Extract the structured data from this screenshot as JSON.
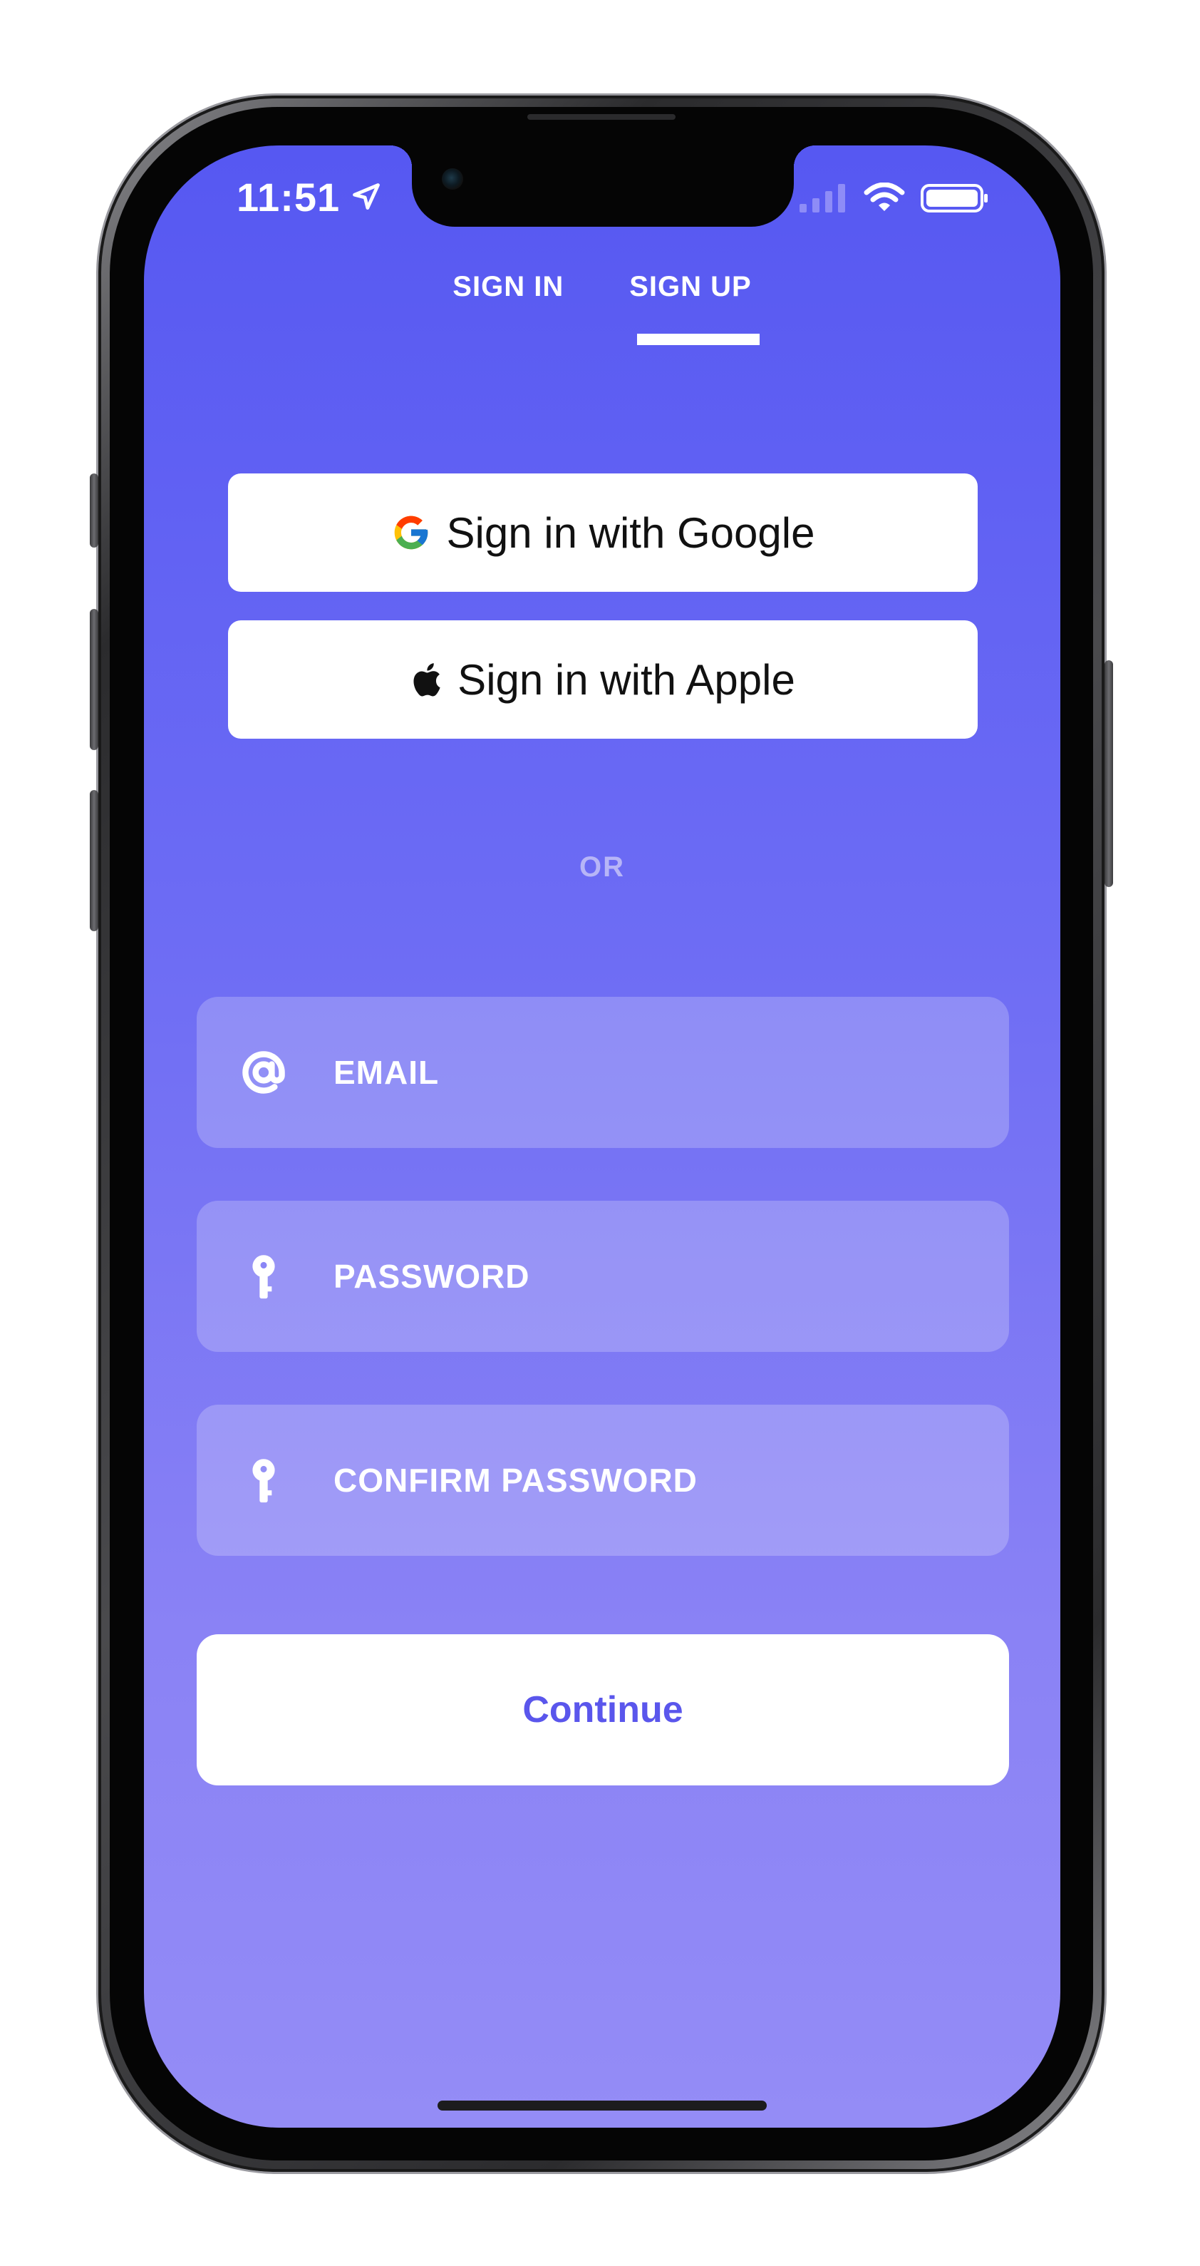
{
  "status_bar": {
    "time": "11:51",
    "location_icon": "location-arrow-icon",
    "signal_icon": "cellular-signal-icon",
    "wifi_icon": "wifi-icon",
    "battery_icon": "battery-icon"
  },
  "tabs": [
    {
      "label": "SIGN IN",
      "selected": false
    },
    {
      "label": "SIGN UP",
      "selected": true
    }
  ],
  "social": {
    "google_label": "Sign in with Google",
    "google_icon": "google-g-icon",
    "apple_label": "Sign in with Apple",
    "apple_icon": "apple-logo-icon"
  },
  "divider_label": "OR",
  "form": {
    "email": {
      "placeholder": "EMAIL",
      "icon": "at-sign-icon",
      "value": ""
    },
    "password": {
      "placeholder": "PASSWORD",
      "icon": "key-icon",
      "value": ""
    },
    "confirm_password": {
      "placeholder": "CONFIRM PASSWORD",
      "icon": "key-icon",
      "value": ""
    }
  },
  "continue_label": "Continue",
  "colors": {
    "background_top": "#5658f2",
    "background_bottom": "#948cf6",
    "accent_text": "#5a56ec",
    "button_bg": "#ffffff"
  }
}
